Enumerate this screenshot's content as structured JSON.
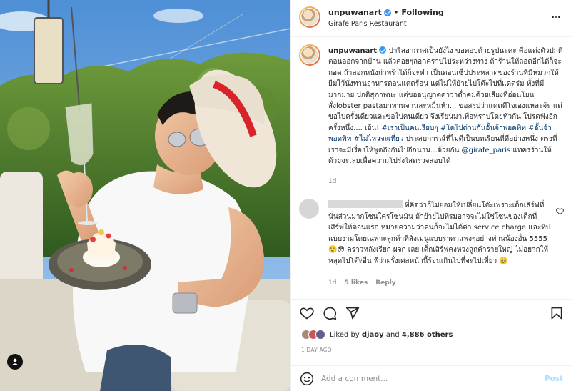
{
  "post": {
    "username": "unpuwanart",
    "following_label": "Following",
    "location": "Girafe Paris Restaurant",
    "caption_parts": {
      "text1": "ปารีสอากาศเป็นยังไง ขอตอบด้วยรูปนะคะ คือแต่งตัวปกติตอนออกจากบ้าน แล้วค่อยๆลอกคราบไประหว่างทาง ถ้าร้านให้ถอดอีกได้ก็จะถอด ถ้าลอกหนังก่าพร้าได้ก็จะทำ เป็นตอนเซ็ปประหลาดของร้านที่มีหมวกให้ยืมไว้นั่งทานอาหารตอนแดดร้อน แต่ไม่ให้ย้ายไปโต๊ะไปที่แดดร่ม ทั้งที่มีมากมาย ปกติสุภาพนะ แต่ขออนุญาตด่าว่าต่ำคมด้วยเสียงที่อ่อนโยน สั่งlobster pastaมาทานจานละหมื่นห้า... ขอสรุปว่าแดดดีโจเองแหละจ้ะ แต่ขอไปครั้งเดียวและขอไปคนเดียว จึงเรียนมาเพื่อทราบโดยทั่วกัน โปรดฟังอีกครั้งหนึ่ง.... เย้น! ",
      "tags1": "#เราเป็นคนเรียบๆ #โดไปด่วนกันอั้นจ้าพอดพิท #อั้นจ้าพอดพิท #ไม่ไหวจะเที่ยว",
      "text2": " ประสบการณ์ที่ไม่ดีเป็นบทเรียนที่ดีอย่างหนึ่ง ตรงที่เราจะมีเรื่องให้พูดถึงกันไปอีกนาน...ด้วยกัน ",
      "mention": "@girafe_paris",
      "text3": " แทครร้านให้ด้วยจะเลยเพื่อความโปร่งใสตรวจสอบได้"
    },
    "caption_time": "1d",
    "comment": {
      "text": "ที่คิดว่าก็ไม่ยอมให้เปลี่ยนโต๊ะเพราะเด็กเสิร์ฟที่นั่นส่วนมากโซนใครโซนมัน ถ้าย้ายไปที่รมอาจจะไม่ใช่โซนของเด็กที่เสิร์ฟให้ตอนแรก หมายความว่าคนก็จะไม่ได้ค่า service charge และทิปแบบงามโดยเฉพาะลูกค้าที่สั่งเมนูแบบราคาแพงๆอย่างท่านน้องอั้น 5555 😮‍💨😳 คราวหลังเรียก ผจก เลย เด็กเสิร์ฟคงหวงลูกค้ารายใหญ่ ไม่อยากให้หลุดไปโต๊ะอื่น พี่ว่าฝรั่งเศสหน้านี้ร้อนเกินไปที่จะไปเที่ยว 🥺",
      "time": "1d",
      "likes": "5 likes",
      "reply": "Reply"
    },
    "likes": {
      "prefix": "Liked by ",
      "user": "djaoy",
      "mid": " and ",
      "count": "4,886 others"
    },
    "date": "1 DAY AGO",
    "add_comment_placeholder": "Add a comment...",
    "post_button": "Post"
  },
  "icons": {
    "verified": "verified-badge-icon",
    "more": "more-options-icon",
    "heart": "heart-icon",
    "comment": "comment-icon",
    "share": "share-icon",
    "save": "bookmark-icon",
    "emoji": "emoji-icon",
    "user_tag": "user-tag-icon"
  },
  "colors": {
    "link": "#00376b",
    "meta": "#8e8e8e",
    "post_button": "#b2dffc",
    "verified": "#3897f0"
  }
}
